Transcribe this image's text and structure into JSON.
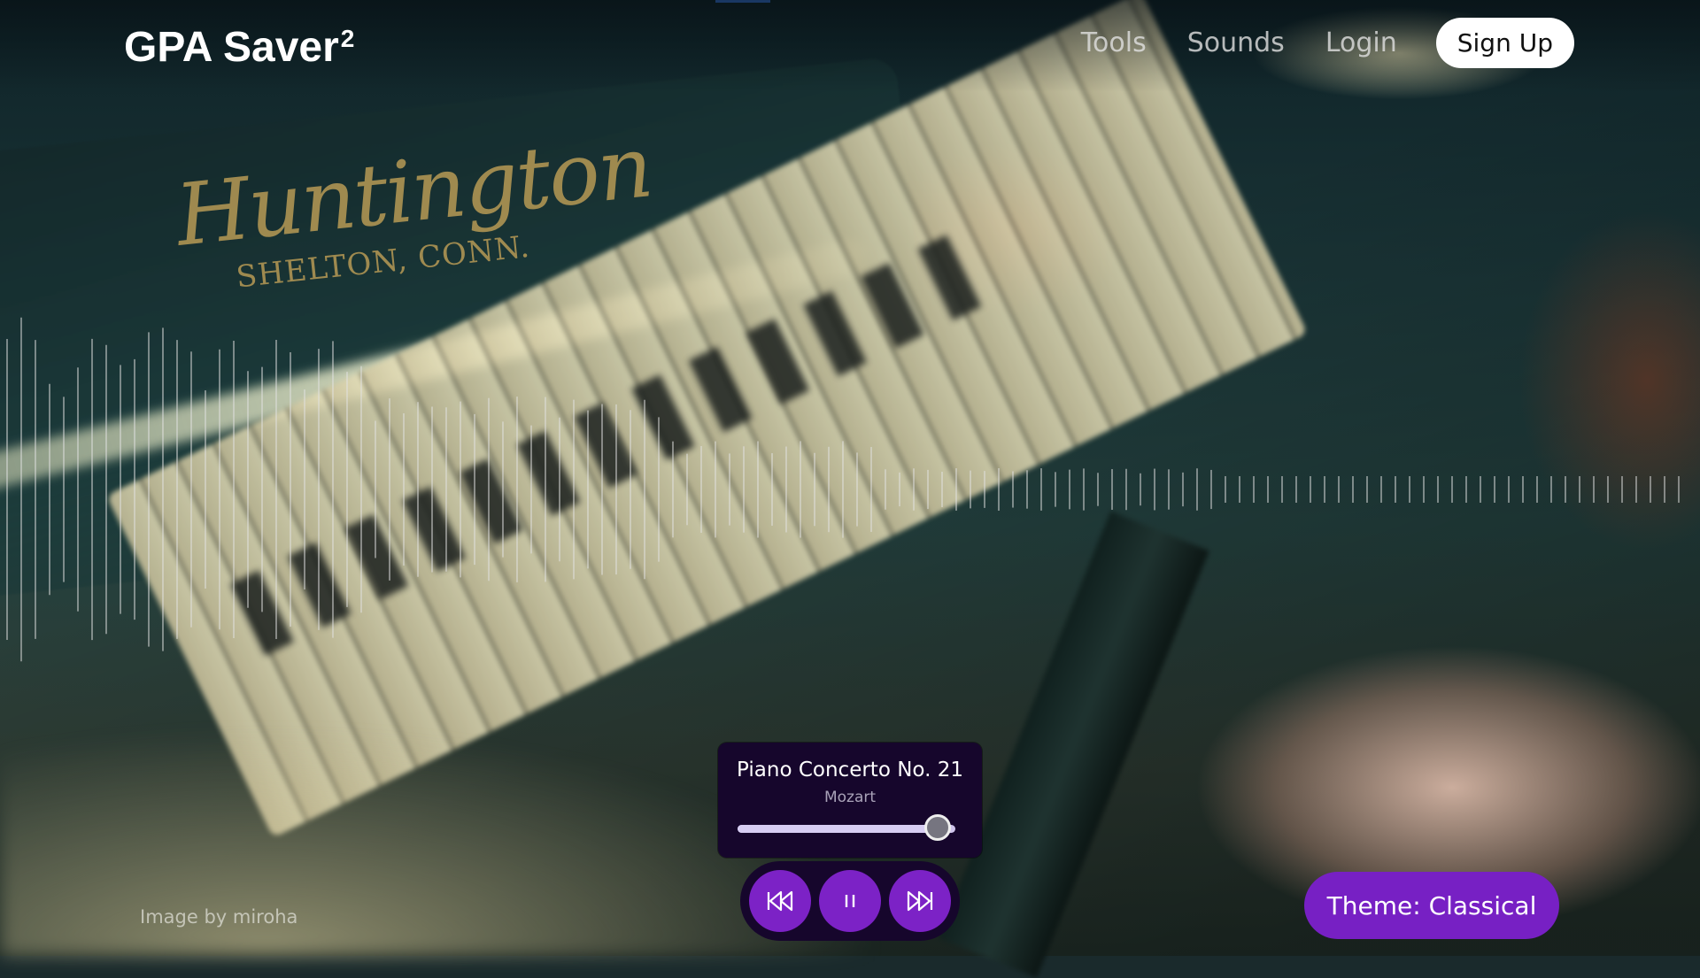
{
  "header": {
    "logo_text": "GPA Saver",
    "logo_superscript": "2",
    "nav": {
      "tools": "Tools",
      "sounds": "Sounds",
      "login": "Login",
      "signup": "Sign Up"
    }
  },
  "background": {
    "brand_name": "Huntington",
    "brand_subtitle": "SHELTON, CONN."
  },
  "player": {
    "title": "Piano Concerto No. 21",
    "artist": "Mozart",
    "progress": 0.92,
    "state": "playing",
    "controls": {
      "previous_icon": "skip-back-icon",
      "pause_icon": "pause-icon",
      "next_icon": "skip-forward-icon"
    }
  },
  "footer": {
    "credit": "Image by miroha",
    "theme_button": "Theme: Classical"
  },
  "colors": {
    "accent": "#7720c4",
    "player_bg": "#16062c",
    "signup_bg": "#ffffff",
    "progress_bar": "#3b82f6"
  }
}
